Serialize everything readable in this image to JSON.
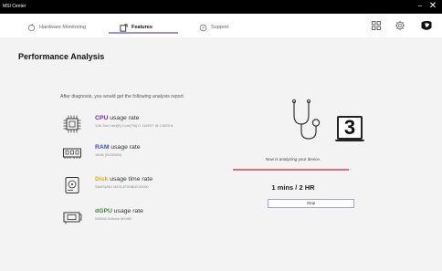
{
  "titlebar": {
    "title": "MSI Center",
    "minimize_icon": "minimize-icon",
    "close_icon": "close-icon",
    "minimize_glyph": "−",
    "close_glyph": "✕"
  },
  "nav": {
    "tabs": [
      {
        "label": "Hardware Monitoring",
        "icon": "refresh-icon",
        "active": false
      },
      {
        "label": "Features",
        "icon": "features-icon",
        "active": true
      },
      {
        "label": "Support",
        "icon": "support-icon",
        "active": false
      }
    ],
    "accent_color": "#9b8ee6",
    "right_icons": [
      "grid-icon",
      "settings-icon",
      "msi-logo-icon"
    ]
  },
  "page": {
    "title": "Performance Analysis",
    "intro": "After diagnosis, you would get the following analysis report."
  },
  "metrics": [
    {
      "key": "CPU",
      "suffix": "usage rate",
      "detail": "11th Gen Intel(R) Core(TM) i7-1165G7 @ 2.80GHz",
      "color": "#6a27b8",
      "icon": "cpu-icon"
    },
    {
      "key": "RAM",
      "suffix": "usage rate",
      "detail": "16GB (SODIMM)",
      "color": "#2f4fd6",
      "icon": "ram-icon"
    },
    {
      "key": "Disk",
      "suffix": "usage time rate",
      "detail": "SAMSUNG MZVL8T0HBLB-00000",
      "color": "#d9b21f",
      "icon": "disk-icon"
    },
    {
      "key": "dGPU",
      "suffix": "usage rate",
      "detail": "NVIDIA Geforce MX450",
      "color": "#3b8a39",
      "icon": "gpu-icon"
    }
  ],
  "analysis": {
    "icon": "stethoscope-icon",
    "count": "3",
    "status": "Now is analyzing your device.",
    "progress_fraction": 0.98,
    "progress_color": "#e36c7a",
    "time": "1 mins / 2 HR",
    "stop_label": "Stop"
  }
}
